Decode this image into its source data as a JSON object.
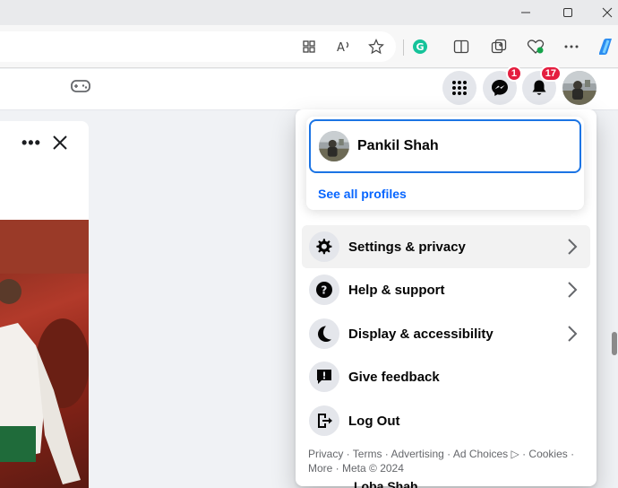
{
  "account": {
    "name": "Pankil Shah",
    "see_all": "See all profiles"
  },
  "badges": {
    "messenger": "1",
    "notifications": "17"
  },
  "menu": {
    "items": [
      {
        "label": "Settings & privacy",
        "icon": "gear-icon"
      },
      {
        "label": "Help & support",
        "icon": "question-icon"
      },
      {
        "label": "Display & accessibility",
        "icon": "moon-icon"
      },
      {
        "label": "Give feedback",
        "icon": "feedback-icon"
      },
      {
        "label": "Log Out",
        "icon": "logout-icon"
      }
    ]
  },
  "footer": {
    "line1": "Privacy · Terms · Advertising · Ad Choices ▷ · Cookies ·",
    "line2": "More · Meta © 2024"
  },
  "partial_name": "Loba Shah",
  "colors": {
    "accent": "#1b74e4",
    "link": "#0866ff",
    "badge": "#e41e3f",
    "icon_bg": "#e4e6eb"
  }
}
